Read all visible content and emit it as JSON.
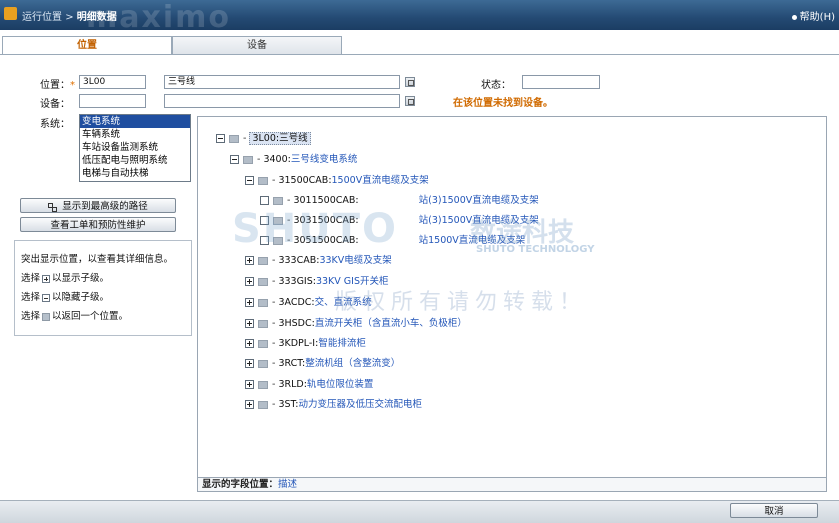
{
  "topbar": {
    "breadcrumb_1": "运行位置",
    "breadcrumb_sep": ">",
    "breadcrumb_2": "明细数据",
    "watermark": "maximo",
    "help": "帮助(H)"
  },
  "tabs": [
    {
      "label": "位置"
    },
    {
      "label": "设备"
    }
  ],
  "form": {
    "location_label": "位置：",
    "required_mark": "*",
    "location_value": "3L00",
    "location_desc": "三号线",
    "asset_label": "设备：",
    "asset_value": "",
    "asset_desc": "",
    "status_label": "状态：",
    "status_value": "",
    "warning": "在该位置未找到设备。",
    "system_label": "系统："
  },
  "systems": [
    {
      "label": "变电系统",
      "selected": true
    },
    {
      "label": "车辆系统",
      "selected": false
    },
    {
      "label": "车站设备监测系统",
      "selected": false
    },
    {
      "label": "低压配电与照明系统",
      "selected": false
    },
    {
      "label": "电梯与自动扶梯",
      "selected": false
    }
  ],
  "buttons": {
    "show_top_path": "显示到最高级的路径",
    "view_work_orders": "查看工单和预防性维护",
    "cancel": "取消"
  },
  "help": {
    "line1": "突出显示位置，以查看其详细信息。",
    "line2_pre": "选择",
    "line2_post": "以显示子级。",
    "line3_pre": "选择",
    "line3_post": "以隐藏子级。",
    "line4_pre": "选择",
    "line4_post": "以返回一个位置。"
  },
  "tree": [
    {
      "code": "3L00",
      "desc": "三号线",
      "level": 0,
      "toggle": "minus",
      "selected": true
    },
    {
      "code": "3400",
      "desc": "三号线变电系统",
      "level": 1,
      "toggle": "minus"
    },
    {
      "code": "31500CAB",
      "desc": "1500V直流电缆及支架",
      "level": 2,
      "toggle": "minus"
    },
    {
      "code": "3011500CAB",
      "desc": "站(3)1500V直流电缆及支架",
      "level": 3,
      "toggle": "empty"
    },
    {
      "code": "3031500CAB",
      "desc": "站(3)1500V直流电缆及支架",
      "level": 3,
      "toggle": "empty"
    },
    {
      "code": "3051500CAB",
      "desc": "站1500V直流电缆及支架",
      "level": 3,
      "toggle": "empty"
    },
    {
      "code": "333CAB",
      "desc": "33KV电缆及支架",
      "level": 2,
      "toggle": "plus"
    },
    {
      "code": "333GIS",
      "desc": "33KV GIS开关柜",
      "level": 2,
      "toggle": "plus"
    },
    {
      "code": "3ACDC",
      "desc": "交、直流系统",
      "level": 2,
      "toggle": "plus"
    },
    {
      "code": "3HSDC",
      "desc": "直流开关柜（含直流小车、负极柜）",
      "level": 2,
      "toggle": "plus"
    },
    {
      "code": "3KDPL-I",
      "desc": "智能排流柜",
      "level": 2,
      "toggle": "plus"
    },
    {
      "code": "3RCT",
      "desc": "整流机组（含整流变）",
      "level": 2,
      "toggle": "plus"
    },
    {
      "code": "3RLD",
      "desc": "轨电位限位装置",
      "level": 2,
      "toggle": "plus"
    },
    {
      "code": "3ST",
      "desc": "动力变压器及低压交流配电柜",
      "level": 2,
      "toggle": "plus"
    }
  ],
  "tree_footer": {
    "label": "显示的字段位置：",
    "value": "描述"
  },
  "watermarks": {
    "brand_en": "SHUTO",
    "brand_cn": "数途科技",
    "brand_sub": "SHUTO TECHNOLOGY",
    "copyright": "版权所有请勿转载！"
  }
}
